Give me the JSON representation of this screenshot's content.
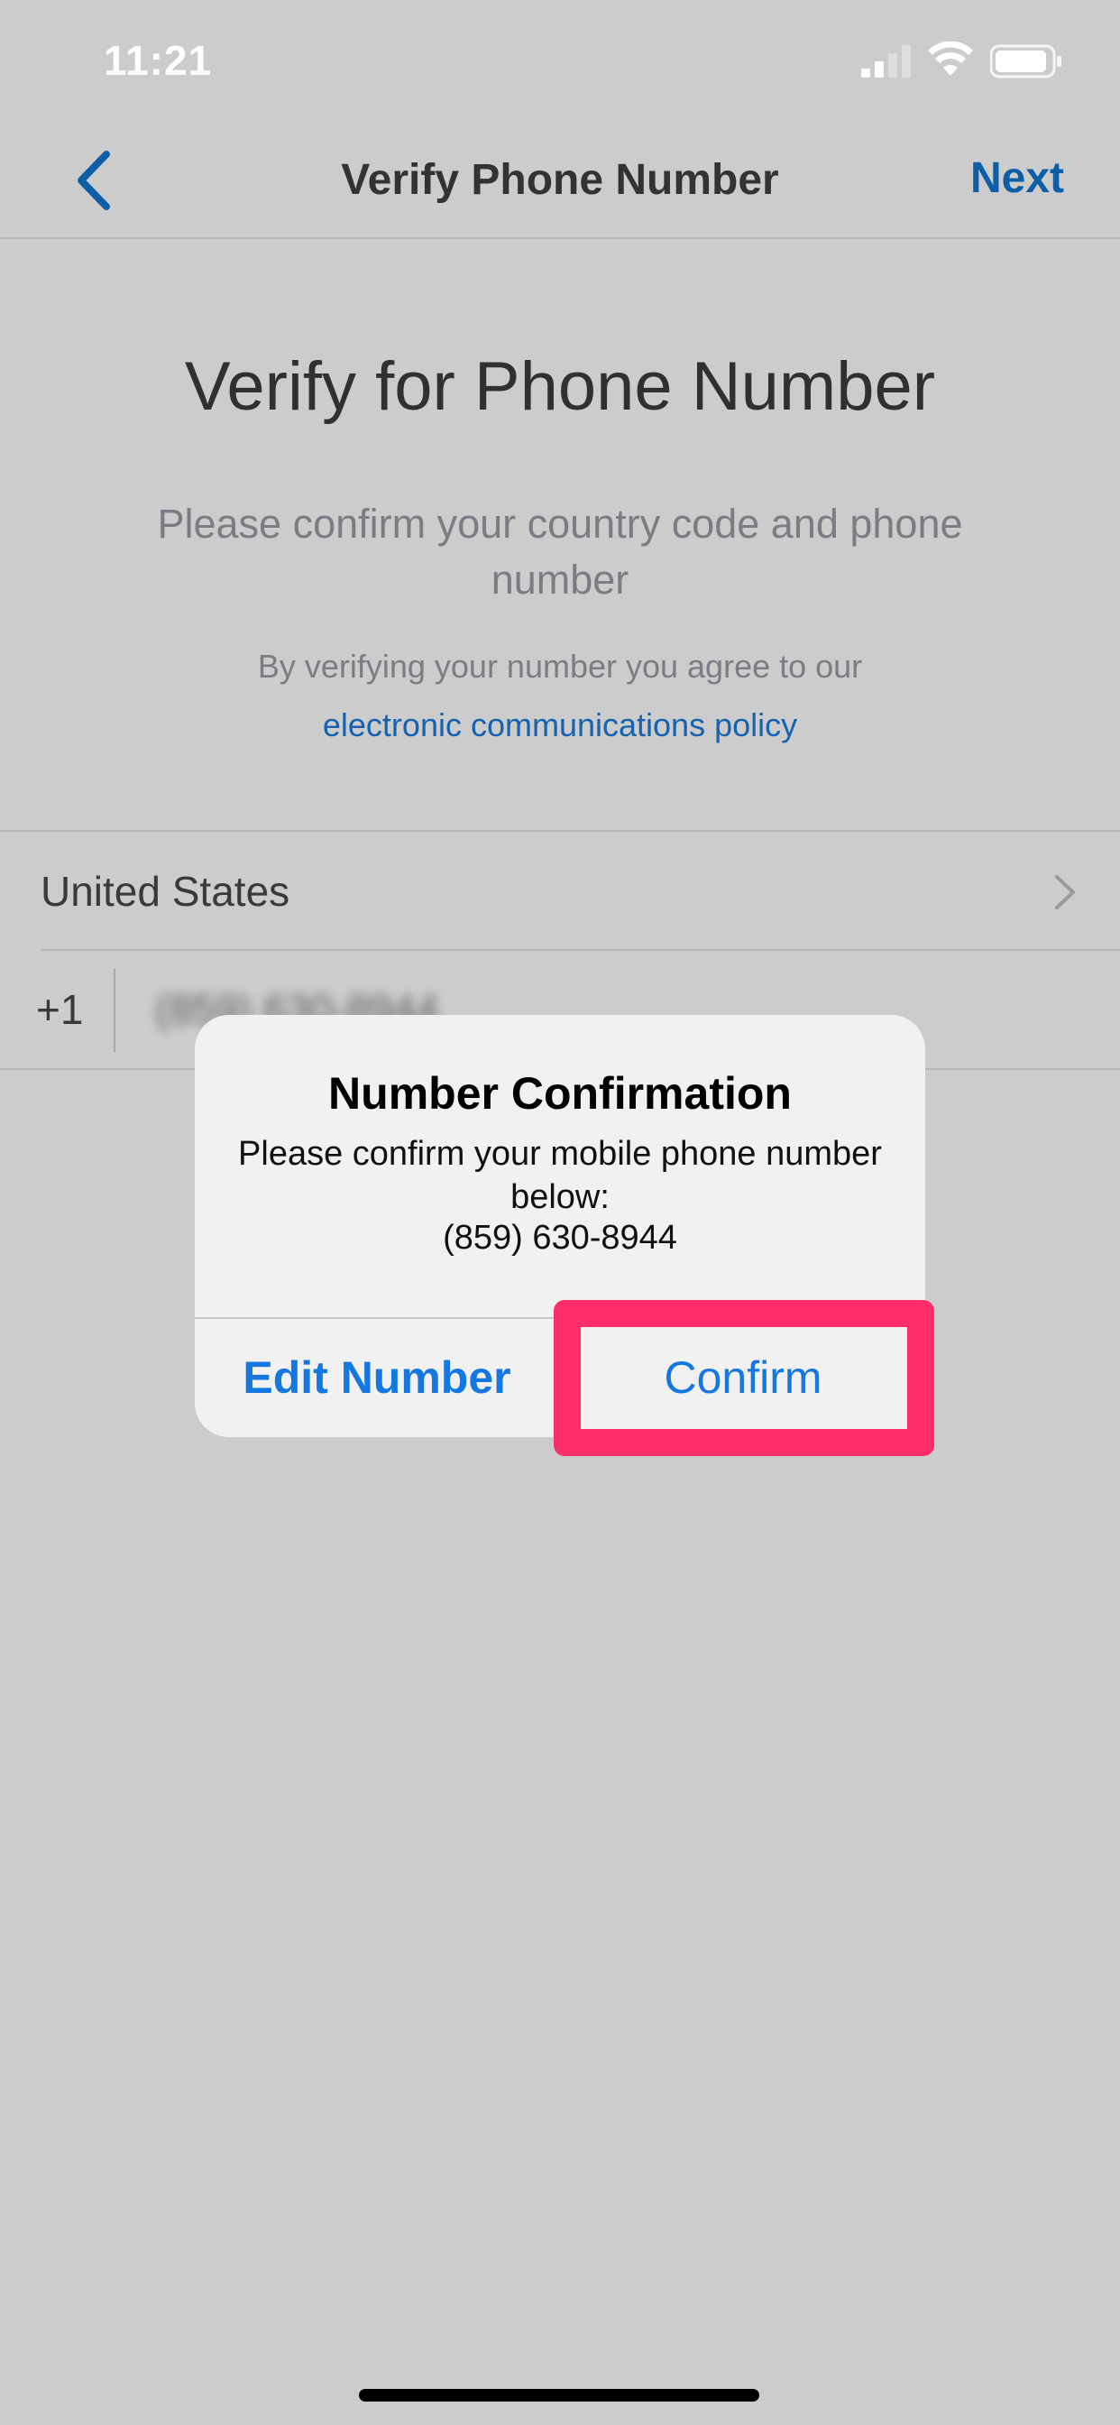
{
  "status_bar": {
    "time": "11:21",
    "signal_icon": "cellular-signal-icon",
    "wifi_icon": "wifi-icon",
    "battery_icon": "battery-icon"
  },
  "nav": {
    "back_icon": "chevron-left-icon",
    "title": "Verify Phone Number",
    "next_label": "Next"
  },
  "content": {
    "title": "Verify for Phone Number",
    "subtitle": "Please confirm your country code and phone number",
    "agree_text": "By verifying your number you agree to our",
    "policy_link": "electronic communications policy"
  },
  "form": {
    "country": "United States",
    "country_code": "+1",
    "phone_value": "(859) 630-8944"
  },
  "alert": {
    "title": "Number Confirmation",
    "message": "Please confirm your mobile phone number below:",
    "number": "(859) 630-8944",
    "edit_label": "Edit Number",
    "confirm_label": "Confirm"
  },
  "colors": {
    "accent": "#1577e0",
    "nav_accent": "#0d5ea6",
    "highlight": "#ff2d6a",
    "background": "#cccccc"
  }
}
